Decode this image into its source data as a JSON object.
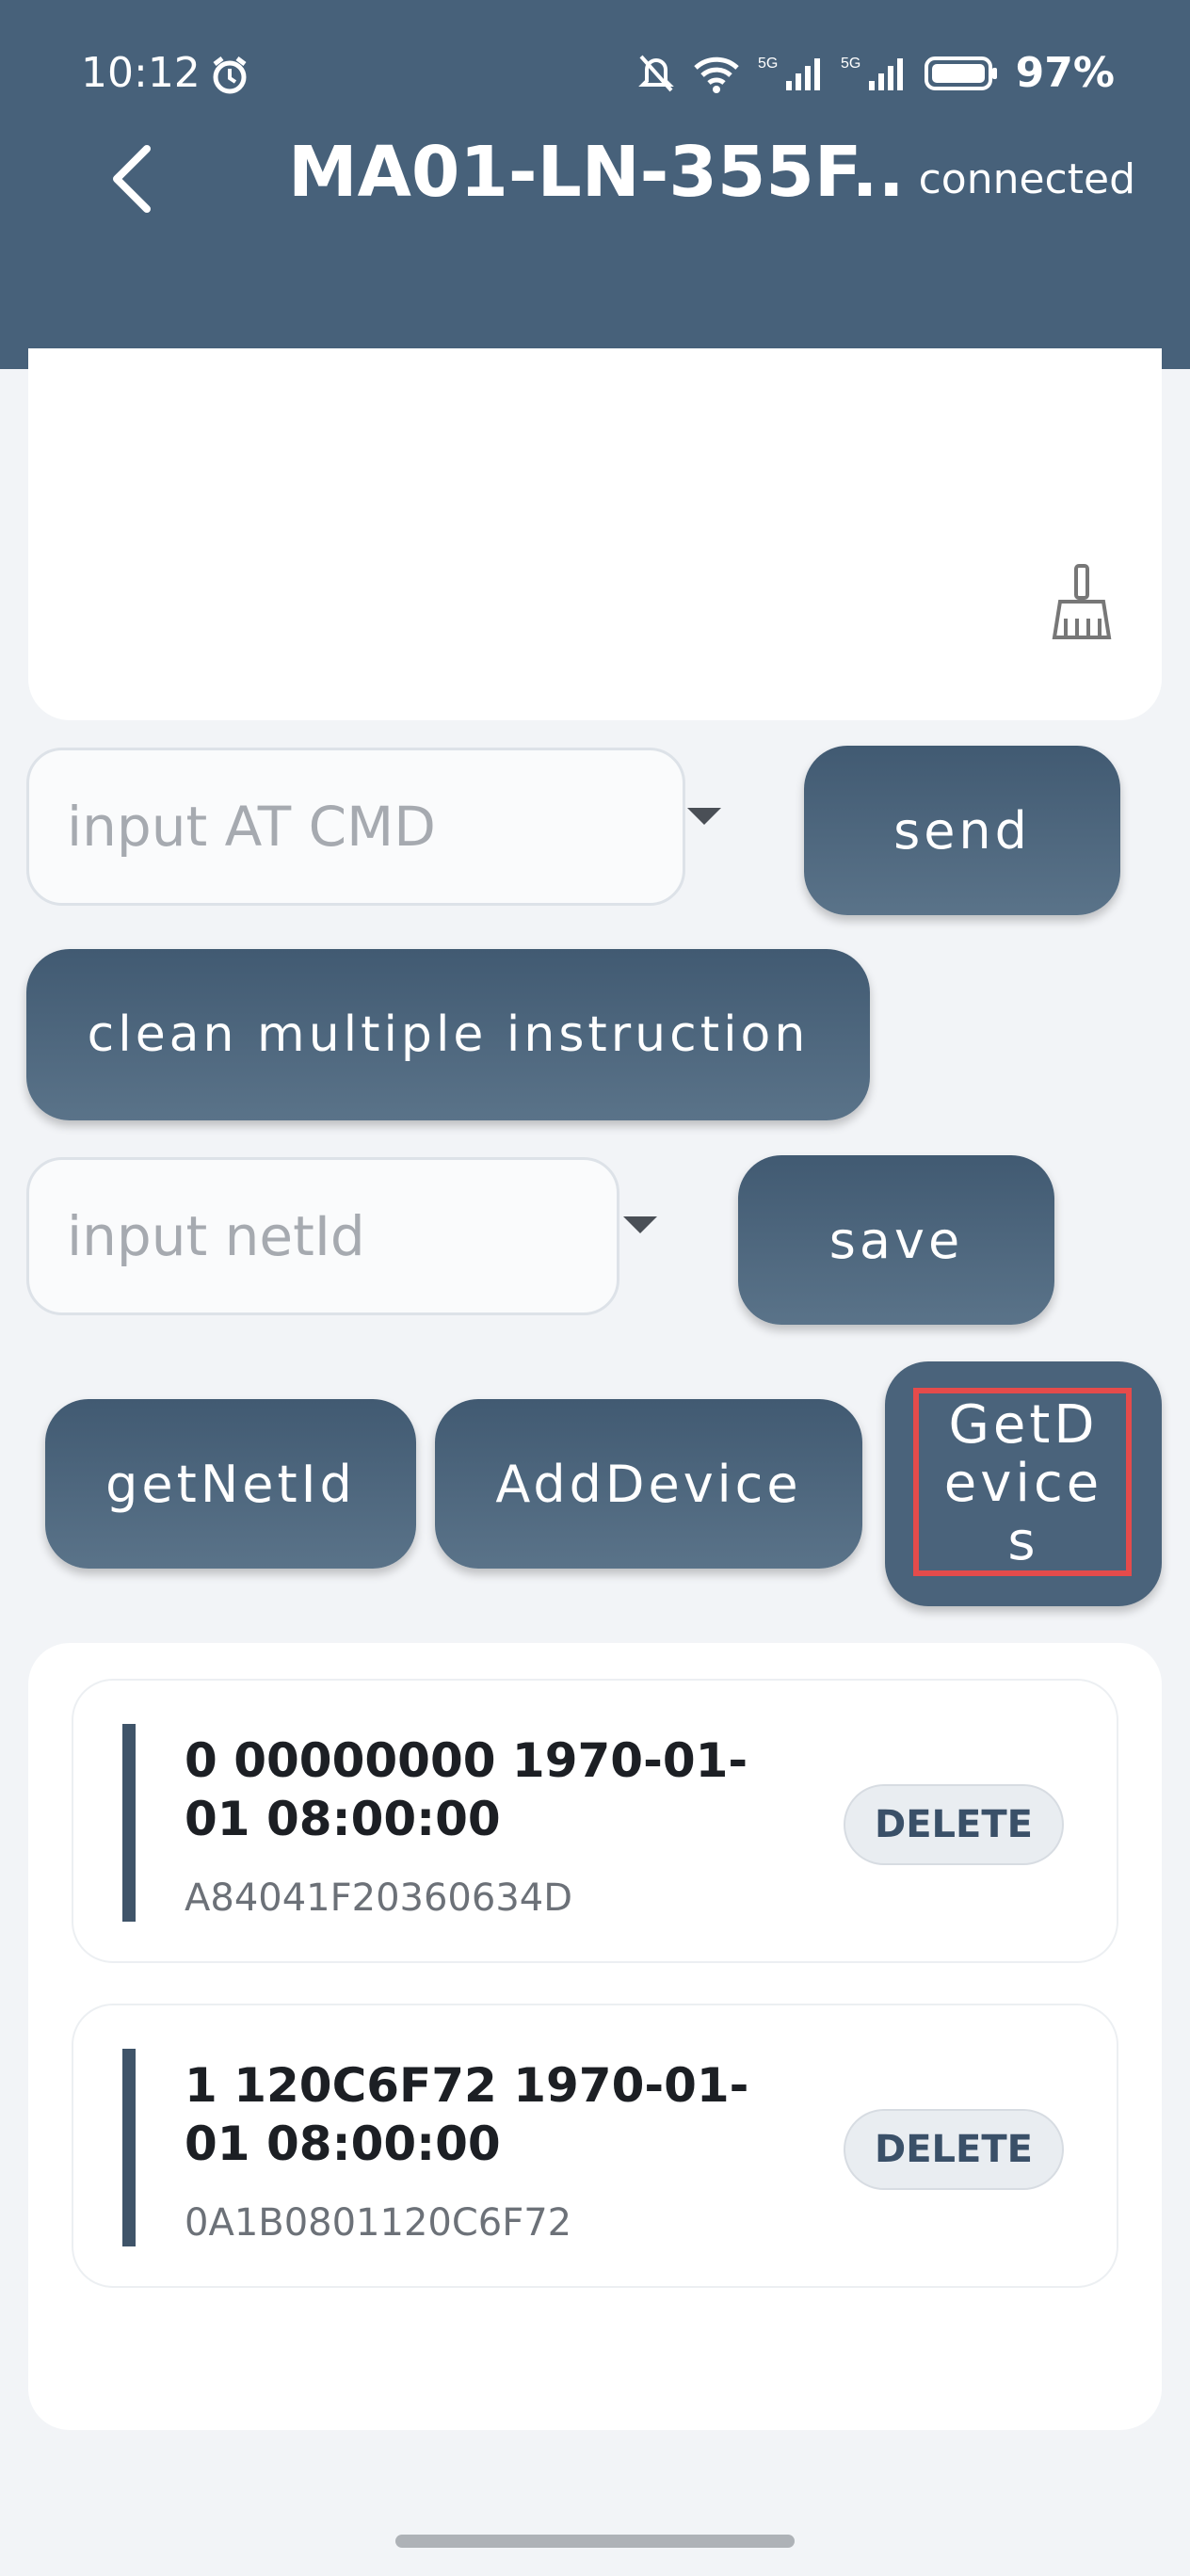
{
  "status_bar": {
    "time": "10:12",
    "battery": "97%",
    "icons": [
      "alarm-icon",
      "mute-icon",
      "wifi-icon",
      "signal-5g-icon",
      "signal-5g-icon",
      "battery-icon"
    ]
  },
  "header": {
    "back_icon": "chevron-left-icon",
    "title": "MA01-LN-355F...",
    "status": "connected"
  },
  "log": {
    "clear_icon": "broom-icon"
  },
  "at_cmd": {
    "placeholder": "input AT CMD",
    "send_label": "send"
  },
  "clean_label": "clean multiple instruction",
  "netid": {
    "placeholder": "input netId",
    "save_label": "save"
  },
  "actions": {
    "get_net_id": "getNetId",
    "add_device": "AddDevice",
    "get_devices": "GetDevices"
  },
  "devices": [
    {
      "title": "0 00000000 1970-01-01 08:00:00",
      "id": "A84041F20360634D",
      "delete_label": "DELETE"
    },
    {
      "title": "1 120C6F72 1970-01-01 08:00:00",
      "id": "0A1B0801120C6F72",
      "delete_label": "DELETE"
    }
  ],
  "colors": {
    "header": "#47617a",
    "button": "#4a637b",
    "highlight": "#e54b4b"
  }
}
